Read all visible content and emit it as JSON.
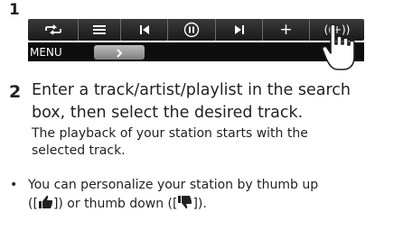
{
  "step1": {
    "number": "1"
  },
  "toolbar": {
    "buttons": [
      {
        "name": "shuffle-repeat-icon"
      },
      {
        "name": "list-icon"
      },
      {
        "name": "previous-track-icon"
      },
      {
        "name": "pause-icon"
      },
      {
        "name": "next-track-icon"
      },
      {
        "name": "add-icon",
        "label": "+"
      },
      {
        "name": "create-station-button",
        "label": "((+))"
      }
    ],
    "menu_label": "MENU",
    "menu_arrow_icon": "chevron-right-icon"
  },
  "step2": {
    "number": "2",
    "line1": "Enter a track/artist/playlist in the search",
    "line2": "box, then select the desired track.",
    "sub_line1": "The playback of your station starts with the",
    "sub_line2": "selected track."
  },
  "note": {
    "bullet": "•",
    "line1": "You can personalize your station by thumb up",
    "line2_a": "([",
    "line2_b": "]) or thumb down ([",
    "line2_c": "])."
  },
  "colors": {
    "bar": "#2a2a2a",
    "text": "#231f20"
  }
}
